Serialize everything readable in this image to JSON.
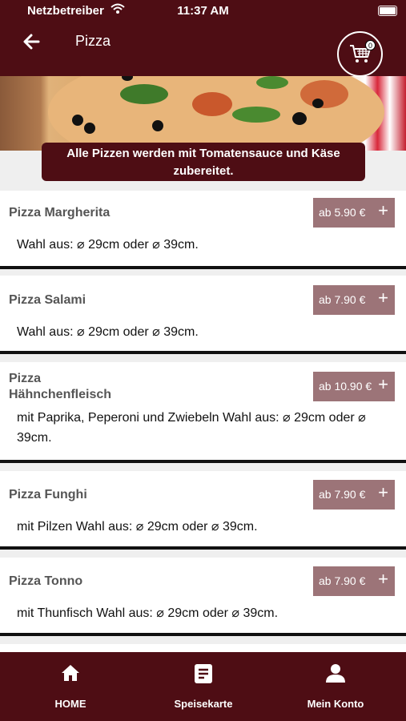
{
  "status_bar": {
    "carrier": "Netzbetreiber",
    "time": "11:37 AM"
  },
  "header": {
    "title": "Pizza",
    "cart_count": "0"
  },
  "banner": {
    "line1": "Alle Pizzen werden mit Tomatensauce und Käse",
    "line2": "zubereitet."
  },
  "items": [
    {
      "name": "Pizza Margherita",
      "price": "ab 5.90 €",
      "desc": "Wahl aus: ⌀ 29cm oder ⌀ 39cm."
    },
    {
      "name": "Pizza Salami",
      "price": "ab 7.90 €",
      "desc": "Wahl aus: ⌀ 29cm oder ⌀ 39cm."
    },
    {
      "name_line1": "Pizza",
      "name_line2": "Hähnchenfleisch",
      "price": "ab 10.90 €",
      "desc_line1": "mit Paprika, Peperoni und Zwiebeln Wahl aus: ⌀ 29cm oder ⌀",
      "desc_line2": "39cm."
    },
    {
      "name": "Pizza Funghi",
      "price": "ab 7.90 €",
      "desc": "mit Pilzen Wahl aus: ⌀ 29cm oder ⌀ 39cm."
    },
    {
      "name": "Pizza Tonno",
      "price": "ab 7.90 €",
      "desc": "mit Thunfisch Wahl aus: ⌀ 29cm oder ⌀ 39cm."
    }
  ],
  "plus_symbol": "+",
  "tabs": [
    {
      "label": "HOME",
      "icon": "home-icon"
    },
    {
      "label": "Speisekarte",
      "icon": "menu-card-icon"
    },
    {
      "label": "Mein Konto",
      "icon": "user-icon"
    }
  ],
  "colors": {
    "brand": "#4e0d14",
    "price_button": "#9c7478"
  }
}
